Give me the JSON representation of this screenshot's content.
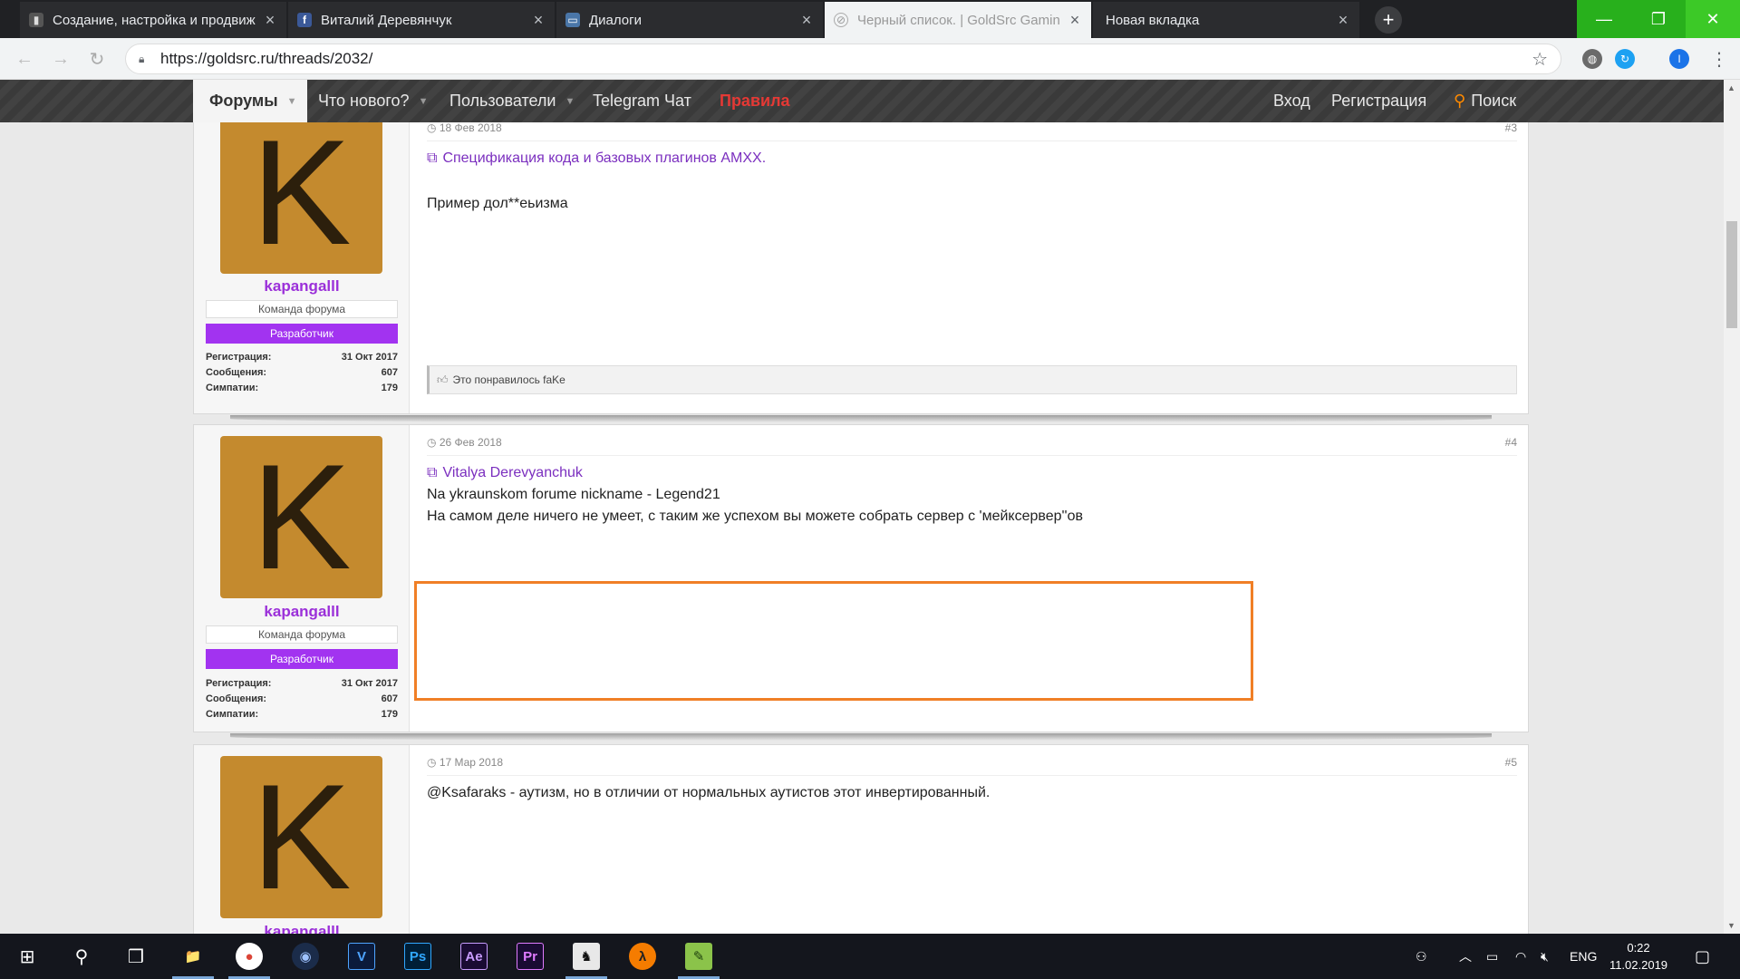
{
  "browser": {
    "tabs": [
      {
        "title": "Создание, настройка и продвиж",
        "icon": "goldsrc-favicon-icon"
      },
      {
        "title": "Виталий Деревянчук",
        "icon": "facebook-icon"
      },
      {
        "title": "Диалоги",
        "icon": "chat-bubble-icon"
      },
      {
        "title": "Черный список. | GoldSrc Gamin",
        "icon": "goldsrc-favicon-icon"
      },
      {
        "title": "Новая вкладка",
        "icon": ""
      }
    ],
    "url": "https://goldsrc.ru/threads/2032/",
    "profile_initial": "I"
  },
  "forum_nav": {
    "forums": "Форумы",
    "whats_new": "Что нового?",
    "users": "Пользователи",
    "telegram": "Telegram Чат",
    "rules": "Правила",
    "login": "Вход",
    "register": "Регистрация",
    "search": "Поиск"
  },
  "posts": [
    {
      "date": "18 Фев 2018",
      "number": "#3",
      "link": "Спецификация кода и базовых плагинов AMXX.",
      "lines": [
        "Пример дол**еьизма"
      ],
      "likes": "Это понравилось faKe",
      "user": {
        "avatar_letter": "K",
        "name": "kapangalll",
        "title": "Команда форума",
        "banner": "Разработчик",
        "stats": [
          {
            "label": "Регистрация:",
            "value": "31 Окт 2017"
          },
          {
            "label": "Сообщения:",
            "value": "607"
          },
          {
            "label": "Симпатии:",
            "value": "179"
          }
        ]
      }
    },
    {
      "date": "26 Фев 2018",
      "number": "#4",
      "link": "Vitalya Derevyanchuk",
      "lines": [
        "Na ykraunskom forume nickname - Legend21",
        "На самом деле ничего не умеет, с таким же успехом вы можете собрать сервер с 'мейксервер''ов"
      ],
      "user": {
        "avatar_letter": "K",
        "name": "kapangalll",
        "title": "Команда форума",
        "banner": "Разработчик",
        "stats": [
          {
            "label": "Регистрация:",
            "value": "31 Окт 2017"
          },
          {
            "label": "Сообщения:",
            "value": "607"
          },
          {
            "label": "Симпатии:",
            "value": "179"
          }
        ]
      }
    },
    {
      "date": "17 Мар 2018",
      "number": "#5",
      "lines": [
        "@Ksafaraks - аутизм, но в отличии от нормальных аутистов этот инвертированный."
      ],
      "user": {
        "avatar_letter": "K",
        "name": "kapangalll"
      }
    }
  ],
  "taskbar": {
    "apps": [
      {
        "name": "file-explorer-icon",
        "label": "📁"
      },
      {
        "name": "chrome-icon",
        "label": "●"
      },
      {
        "name": "cinema4d-icon",
        "label": "◉"
      },
      {
        "name": "vegas-icon",
        "label": "V"
      },
      {
        "name": "photoshop-icon",
        "label": "Ps"
      },
      {
        "name": "after-effects-icon",
        "label": "Ae"
      },
      {
        "name": "premiere-icon",
        "label": "Pr"
      },
      {
        "name": "counter-strike-icon",
        "label": "♞"
      },
      {
        "name": "half-life-icon",
        "label": "λ"
      },
      {
        "name": "notepad-icon",
        "label": "✎"
      }
    ],
    "language": "ENG",
    "time": "0:22",
    "date": "11.02.2019"
  },
  "colors": {
    "accent_purple": "#9b30d9",
    "banner_purple": "#a233f0",
    "highlight_orange": "#f07f26",
    "rules_red": "#e53935",
    "avatar_gold": "#c48a2e"
  }
}
